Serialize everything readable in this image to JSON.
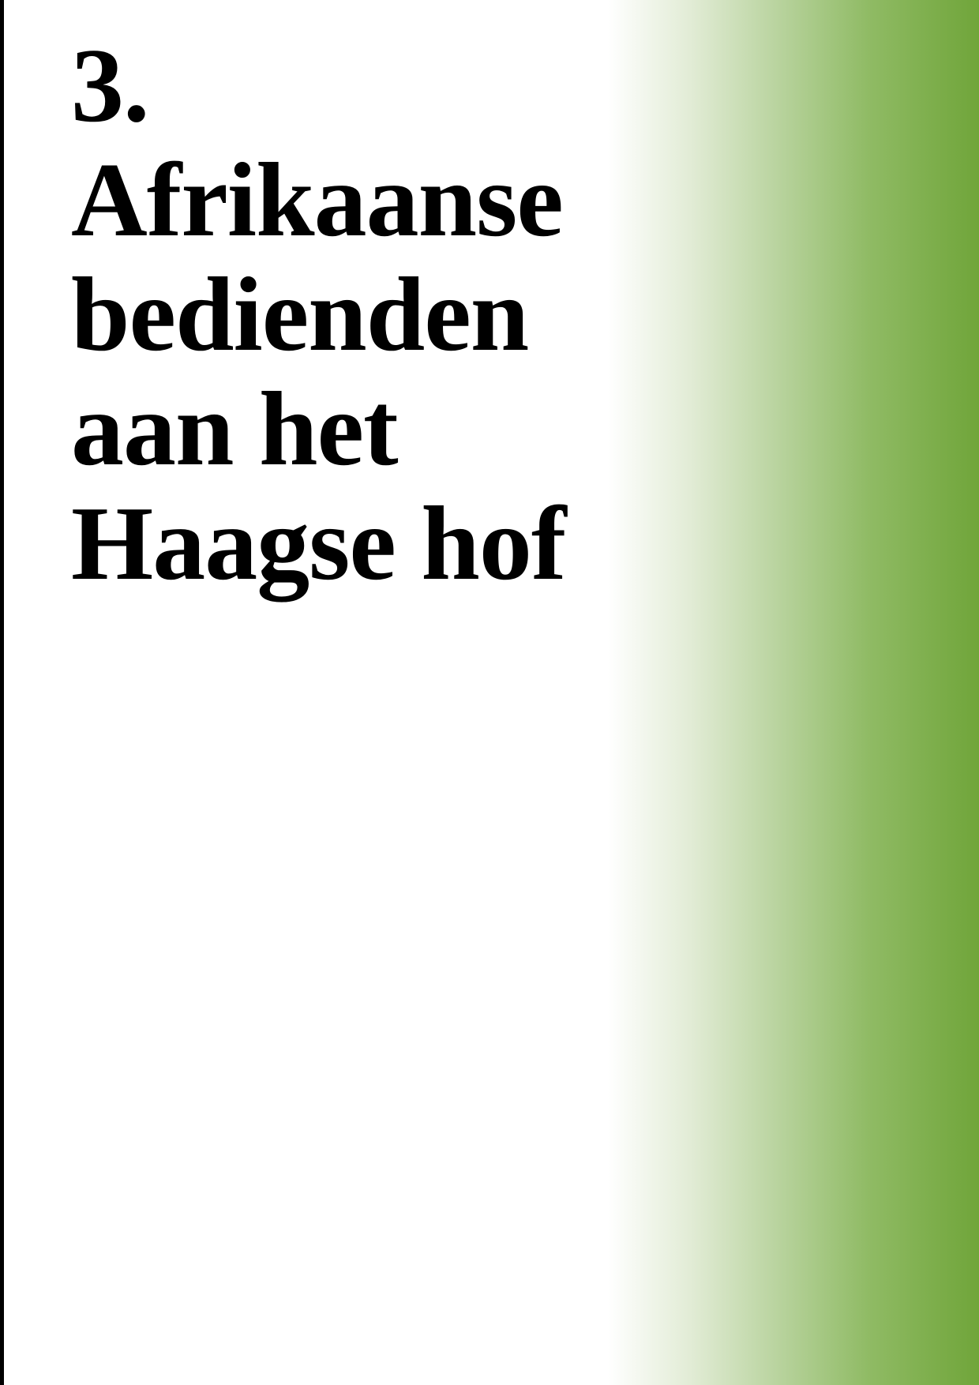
{
  "chapter": {
    "number": "3.",
    "title_lines": [
      "Afrikaanse",
      "bedienden",
      "aan het",
      "Haagse hof"
    ]
  },
  "colors": {
    "accent_green": "#6FA53A",
    "text": "#000000",
    "background": "#FFFFFF"
  }
}
